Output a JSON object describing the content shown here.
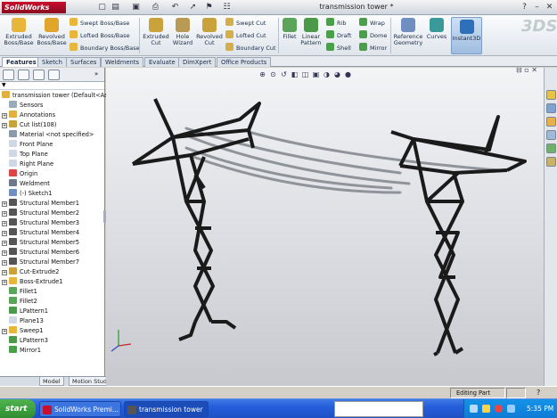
{
  "app": {
    "logo": "SolidWorks",
    "window_title": "transmission tower *"
  },
  "ribbon": {
    "big_buttons": [
      {
        "label": "Extruded Boss/Base",
        "icon": "extrude-boss-icon"
      },
      {
        "label": "Revolved Boss/Base",
        "icon": "revolve-boss-icon"
      },
      {
        "label": "Extruded Cut",
        "icon": "extrude-cut-icon"
      },
      {
        "label": "Hole Wizard",
        "icon": "hole-wizard-icon"
      },
      {
        "label": "Revolved Cut",
        "icon": "revolve-cut-icon"
      },
      {
        "label": "Fillet",
        "icon": "fillet-icon"
      },
      {
        "label": "Linear Pattern",
        "icon": "linear-pattern-icon"
      },
      {
        "label": "Reference Geometry",
        "icon": "reference-geometry-icon"
      },
      {
        "label": "Curves",
        "icon": "curves-icon"
      },
      {
        "label": "Instant3D",
        "icon": "instant3d-icon"
      }
    ],
    "small_buttons": [
      {
        "label": "Swept Boss/Base",
        "icon": "swept-boss-icon"
      },
      {
        "label": "Lofted Boss/Base",
        "icon": "lofted-boss-icon"
      },
      {
        "label": "Boundary Boss/Base",
        "icon": "boundary-boss-icon"
      },
      {
        "label": "Swept Cut",
        "icon": "swept-cut-icon"
      },
      {
        "label": "Lofted Cut",
        "icon": "lofted-cut-icon"
      },
      {
        "label": "Boundary Cut",
        "icon": "boundary-cut-icon"
      },
      {
        "label": "Rib",
        "icon": "rib-icon"
      },
      {
        "label": "Draft",
        "icon": "draft-icon"
      },
      {
        "label": "Shell",
        "icon": "shell-icon"
      },
      {
        "label": "Wrap",
        "icon": "wrap-icon"
      },
      {
        "label": "Dome",
        "icon": "dome-icon"
      },
      {
        "label": "Mirror",
        "icon": "mirror-icon"
      }
    ]
  },
  "tabs": [
    {
      "label": "Features",
      "active": true
    },
    {
      "label": "Sketch"
    },
    {
      "label": "Surfaces"
    },
    {
      "label": "Weldments"
    },
    {
      "label": "Evaluate"
    },
    {
      "label": "DimXpert"
    },
    {
      "label": "Office Products"
    }
  ],
  "tree": {
    "root": "transmission tower  (Default<As M...",
    "items": [
      {
        "label": "Sensors",
        "icon": "sensor-icon",
        "expand": false
      },
      {
        "label": "Annotations",
        "icon": "annotations-icon",
        "expand": true
      },
      {
        "label": "Cut list(108)",
        "icon": "cut-list-icon",
        "expand": true
      },
      {
        "label": "Material <not specified>",
        "icon": "material-icon",
        "expand": false
      },
      {
        "label": "Front Plane",
        "icon": "plane-icon",
        "expand": false
      },
      {
        "label": "Top Plane",
        "icon": "plane-icon",
        "expand": false
      },
      {
        "label": "Right Plane",
        "icon": "plane-icon",
        "expand": false
      },
      {
        "label": "Origin",
        "icon": "origin-icon",
        "expand": false
      },
      {
        "label": "Weldment",
        "icon": "weldment-icon",
        "expand": false
      },
      {
        "label": "(-) Sketch1",
        "icon": "sketch-icon",
        "expand": false
      },
      {
        "label": "Structural Member1",
        "icon": "structural-member-icon",
        "expand": true
      },
      {
        "label": "Structural Member2",
        "icon": "structural-member-icon",
        "expand": true
      },
      {
        "label": "Structural Member3",
        "icon": "structural-member-icon",
        "expand": true
      },
      {
        "label": "Structural Member4",
        "icon": "structural-member-icon",
        "expand": true
      },
      {
        "label": "Structural Member5",
        "icon": "structural-member-icon",
        "expand": true
      },
      {
        "label": "Structural Member6",
        "icon": "structural-member-icon",
        "expand": true
      },
      {
        "label": "Structural Member7",
        "icon": "structural-member-icon",
        "expand": true
      },
      {
        "label": "Cut-Extrude2",
        "icon": "cut-extrude-icon",
        "expand": true
      },
      {
        "label": "Boss-Extrude1",
        "icon": "boss-extrude-icon",
        "expand": true
      },
      {
        "label": "Fillet1",
        "icon": "fillet-icon",
        "expand": false
      },
      {
        "label": "Fillet2",
        "icon": "fillet-icon",
        "expand": false
      },
      {
        "label": "LPattern1",
        "icon": "linear-pattern-icon",
        "expand": false
      },
      {
        "label": "Plane13",
        "icon": "plane-icon",
        "expand": false
      },
      {
        "label": "Sweep1",
        "icon": "sweep-icon",
        "expand": true
      },
      {
        "label": "LPattern3",
        "icon": "linear-pattern-icon",
        "expand": false
      },
      {
        "label": "Mirror1",
        "icon": "mirror-icon",
        "expand": false
      }
    ]
  },
  "panel_tabs": [
    "Model",
    "Motion Study 1"
  ],
  "status": {
    "mode": "Editing Part"
  },
  "taskbar": {
    "start": "start",
    "tasks": [
      "SolidWorks Premi...",
      "transmission tower"
    ],
    "clock": "5:35 PM"
  },
  "colors": {
    "tower": "#1a1a1a",
    "cable": "#8f949a",
    "taskbar": "#245edb",
    "accent_red": "#c8102e"
  }
}
